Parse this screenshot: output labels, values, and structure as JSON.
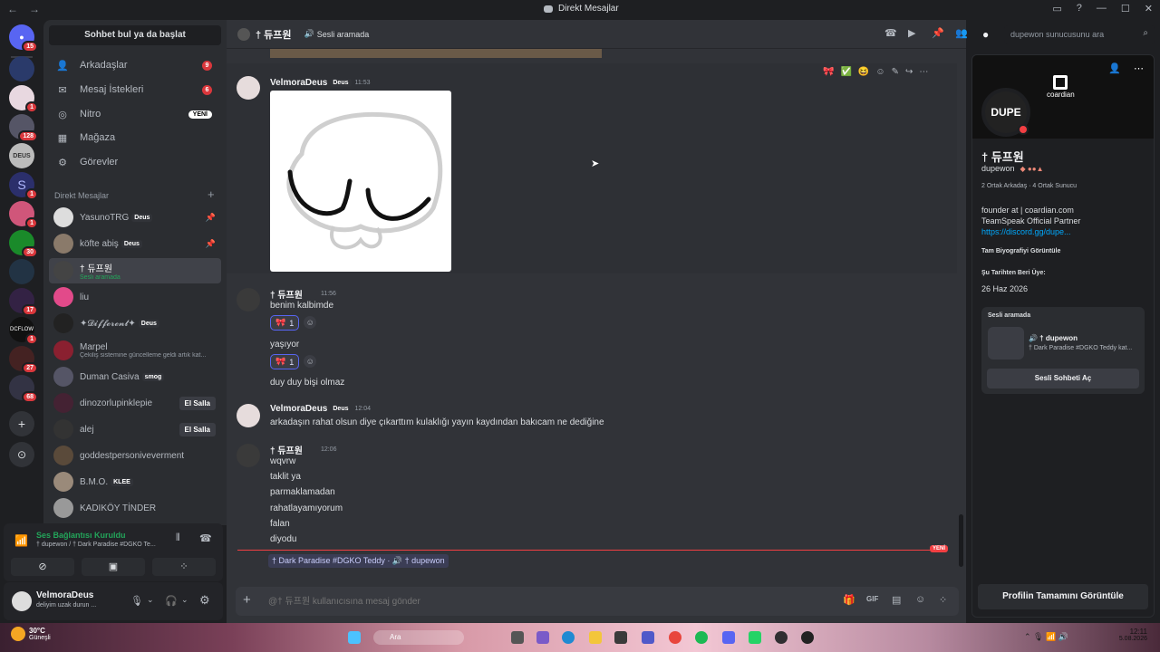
{
  "titlebar": {
    "title": "Direkt Mesajlar"
  },
  "guild_badges": [
    "15",
    "1",
    "128",
    "1",
    "1",
    "30",
    "17",
    "1",
    "27",
    "68"
  ],
  "guild_labels": {
    "deus": "DEUS",
    "dcflow": "DCFLOW"
  },
  "sidebar": {
    "search_label": "Sohbet bul ya da başlat",
    "nav": [
      {
        "label": "Arkadaşlar",
        "icon": "friends-icon",
        "count": "9"
      },
      {
        "label": "Mesaj İstekleri",
        "icon": "mail-icon",
        "count": "6"
      },
      {
        "label": "Nitro",
        "icon": "nitro-icon",
        "badge": "YENİ"
      },
      {
        "label": "Mağaza",
        "icon": "shop-icon"
      },
      {
        "label": "Görevler",
        "icon": "quests-icon"
      }
    ],
    "dm_header": "Direkt Mesajlar",
    "dms": [
      {
        "name": "YasunoTRG",
        "tag": "Deus",
        "pinned": true
      },
      {
        "name": "köfte abiş",
        "tag": "Deus",
        "pinned": true
      },
      {
        "name": "† 듀프원",
        "sub": "Sesli aramada",
        "active": true
      },
      {
        "name": "liu"
      },
      {
        "name": "✦𝓓𝓲𝓯𝓯𝓮𝓻𝓮𝓷𝓽✦",
        "tag": "Deus"
      },
      {
        "name": "Marpel",
        "sub": "Çekiliş sistemine güncelleme geldi artık kat..."
      },
      {
        "name": "Duman Casiva",
        "tag": "smog"
      },
      {
        "name": "dinozorlupinklepie",
        "wave": "El Salla"
      },
      {
        "name": "alej",
        "wave": "El Salla"
      },
      {
        "name": "goddestpersoniveverment"
      },
      {
        "name": "B.M.O.",
        "tag": "KLEE"
      },
      {
        "name": "KADIKÖY TİNDER"
      }
    ]
  },
  "voice": {
    "status": "Ses Bağlantısı Kuruldu",
    "channel": "† dupewon / † Dark Paradise #DGKO Te..."
  },
  "user": {
    "name": "VelmoraDeus",
    "status": "deliyim uzak durun ..."
  },
  "chat": {
    "header_name": "† 듀프원",
    "header_status": "Sesli aramada",
    "search_placeholder": "dupewon sunucusunu ara",
    "messages": [
      {
        "author": "VelmoraDeus",
        "tag": "Deus",
        "time": "11:53",
        "image": true
      },
      {
        "author": "† 듀프원",
        "time": "11:56",
        "lines": [
          "benim kalbimde",
          "yaşıyor",
          "duy duy bişi olmaz"
        ],
        "reaction_count": "1"
      },
      {
        "author": "VelmoraDeus",
        "tag": "Deus",
        "time": "12:04",
        "lines": [
          "arkadaşın rahat olsun diye çıkarttım kulaklığı yayın kaydından bakıcam ne dediğine"
        ]
      },
      {
        "author": "† 듀프원",
        "time": "12:06",
        "lines": [
          "wqvrw",
          "taklit ya",
          "parmaklamadan",
          "rahatlayamıyorum",
          "falan",
          "diyodu"
        ]
      }
    ],
    "new_label": "YENİ",
    "voice_bar": "† Dark Paradise #DGKO Teddy · 🔊 † dupewon",
    "composer_placeholder": "@† 듀프원 kullanıcısına mesaj gönder"
  },
  "profile": {
    "brand": "coardian",
    "display_name": "† 듀프원",
    "username": "dupewon",
    "mutuals": "2 Ortak Arkadaş · 4 Ortak Sunucu",
    "bio1": "founder at | coardian.com",
    "bio2": "TeamSpeak Official Partner",
    "bio_link": "https://discord.gg/dupe...",
    "bio_full": "Tam Biyografiyi Görüntüle",
    "member_since_label": "Şu Tarihten Beri Üye:",
    "member_since": "26 Haz 2026",
    "voice_label": "Sesli aramada",
    "voice_name": "🔊 † dupewon",
    "voice_channel": "† Dark Paradise #DGKO Teddy kat...",
    "voice_button": "Sesli Sohbeti Aç",
    "full_profile_button": "Profilin Tamamını Görüntüle"
  },
  "taskbar": {
    "weather_temp": "30°C",
    "weather_desc": "Güneşli",
    "search": "Ara",
    "time": "12:11",
    "date": "5.08.2026"
  }
}
